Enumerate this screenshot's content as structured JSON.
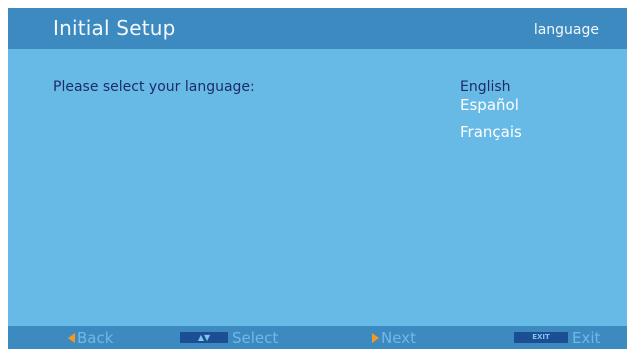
{
  "header": {
    "title": "Initial Setup",
    "section": "language"
  },
  "main": {
    "prompt": "Please select your language:",
    "languages": [
      {
        "label": "English",
        "selected": true
      },
      {
        "label": "Español",
        "selected": false
      },
      {
        "label": "Français",
        "selected": false
      }
    ]
  },
  "footer": {
    "back": {
      "label": "Back",
      "icon": "left-arrow-icon"
    },
    "select": {
      "label": "Select",
      "icon": "up-down-key-icon",
      "key_glyph": "▲▼"
    },
    "next": {
      "label": "Next",
      "icon": "right-arrow-icon"
    },
    "exit": {
      "label": "Exit",
      "icon": "exit-key-icon",
      "key_text": "EXIT"
    }
  },
  "colors": {
    "background": "#67b9e6",
    "bar": "#3d8ac0",
    "selected_text": "#1e2c66",
    "unselected_text": "#ffffff",
    "footer_text": "#6fb8ea",
    "arrow": "#f29a1e",
    "key": "#1c4e93"
  }
}
